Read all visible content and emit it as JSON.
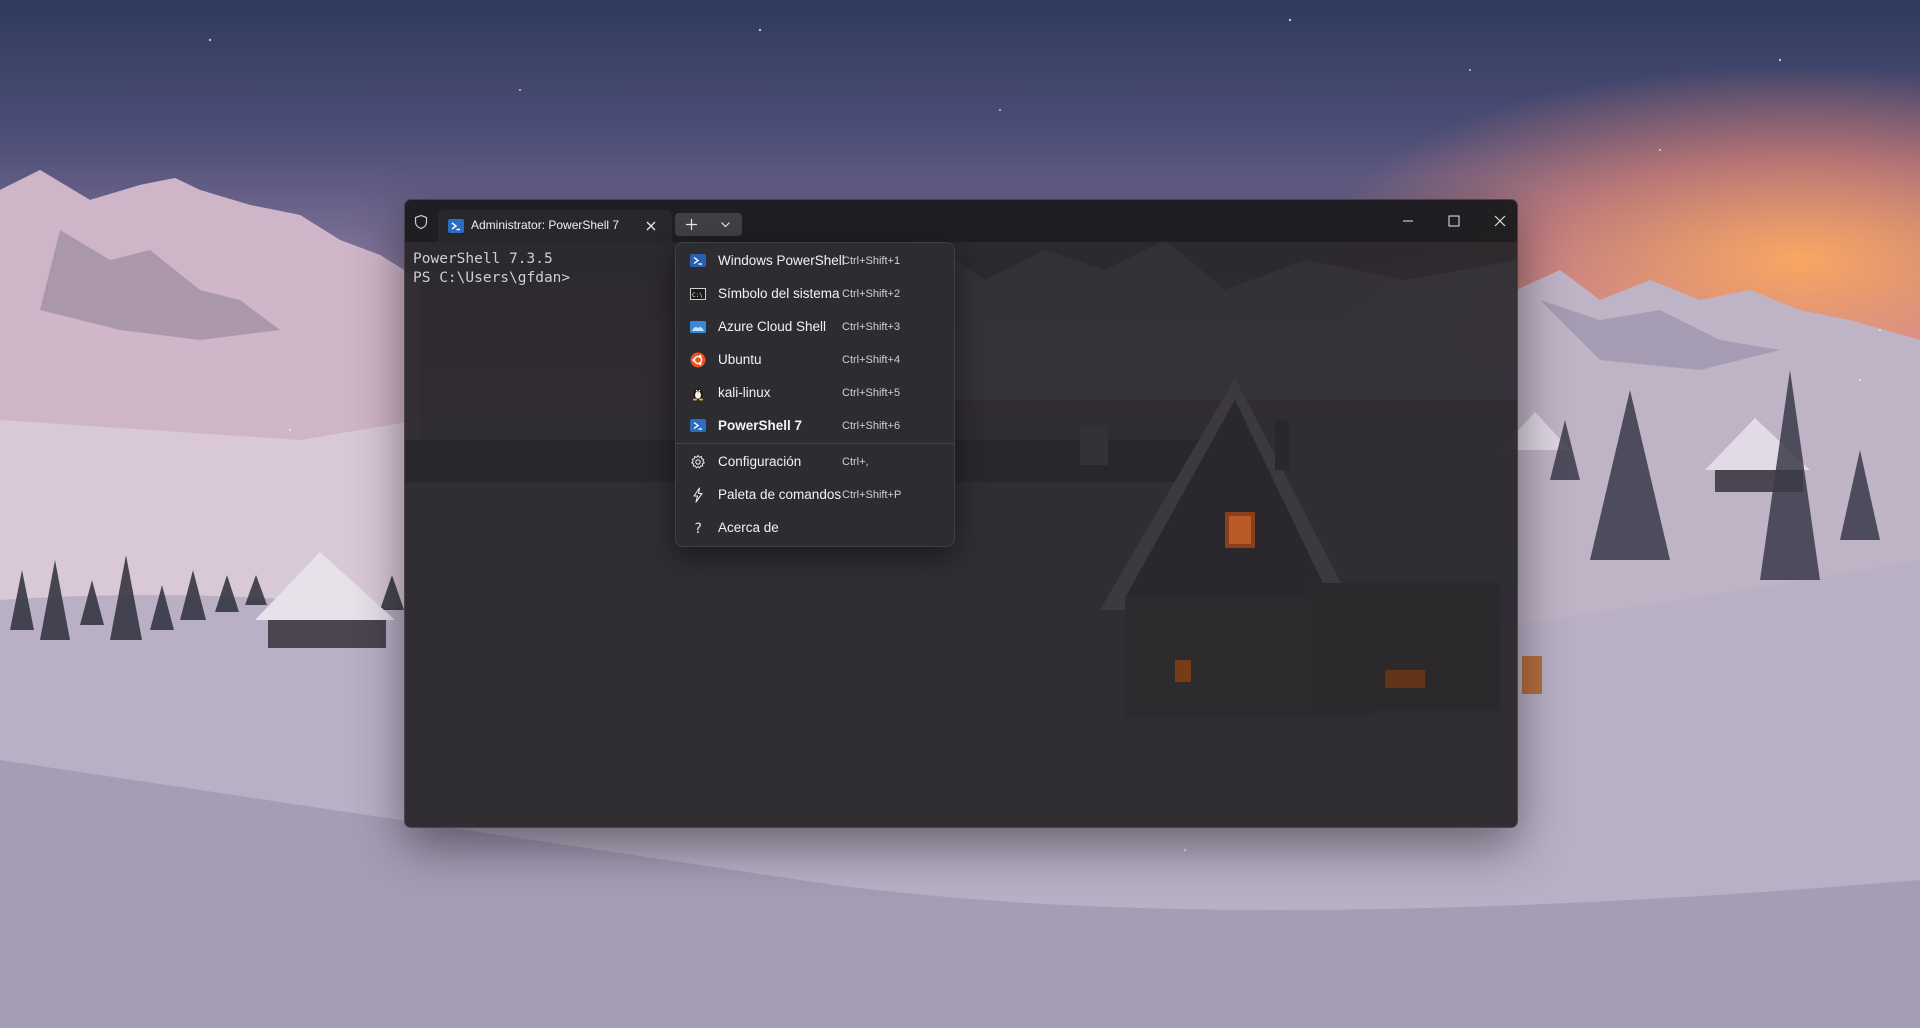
{
  "window": {
    "tab_title": "Administrator: PowerShell 7",
    "tab_icon": "powershell-icon"
  },
  "terminal": {
    "lines": [
      "PowerShell 7.3.5",
      "PS C:\\Users\\gfdan>"
    ]
  },
  "menu": {
    "profiles": [
      {
        "label": "Windows PowerShell",
        "shortcut": "Ctrl+Shift+1",
        "icon": "windows-powershell-icon"
      },
      {
        "label": "Símbolo del sistema",
        "shortcut": "Ctrl+Shift+2",
        "icon": "command-prompt-icon"
      },
      {
        "label": "Azure Cloud Shell",
        "shortcut": "Ctrl+Shift+3",
        "icon": "azure-cloud-shell-icon"
      },
      {
        "label": "Ubuntu",
        "shortcut": "Ctrl+Shift+4",
        "icon": "ubuntu-icon"
      },
      {
        "label": "kali-linux",
        "shortcut": "Ctrl+Shift+5",
        "icon": "kali-linux-icon"
      },
      {
        "label": "PowerShell 7",
        "shortcut": "Ctrl+Shift+6",
        "icon": "powershell-7-icon"
      }
    ],
    "actions": [
      {
        "label": "Configuración",
        "shortcut": "Ctrl+,",
        "icon": "gear-icon"
      },
      {
        "label": "Paleta de comandos",
        "shortcut": "Ctrl+Shift+P",
        "icon": "lightning-icon"
      },
      {
        "label": "Acerca de",
        "shortcut": "",
        "icon": "question-icon"
      }
    ]
  },
  "colors": {
    "powershell_blue": "#2b6cc4",
    "ubuntu_orange": "#e95420",
    "terminal_text": "#cfcfcf"
  }
}
